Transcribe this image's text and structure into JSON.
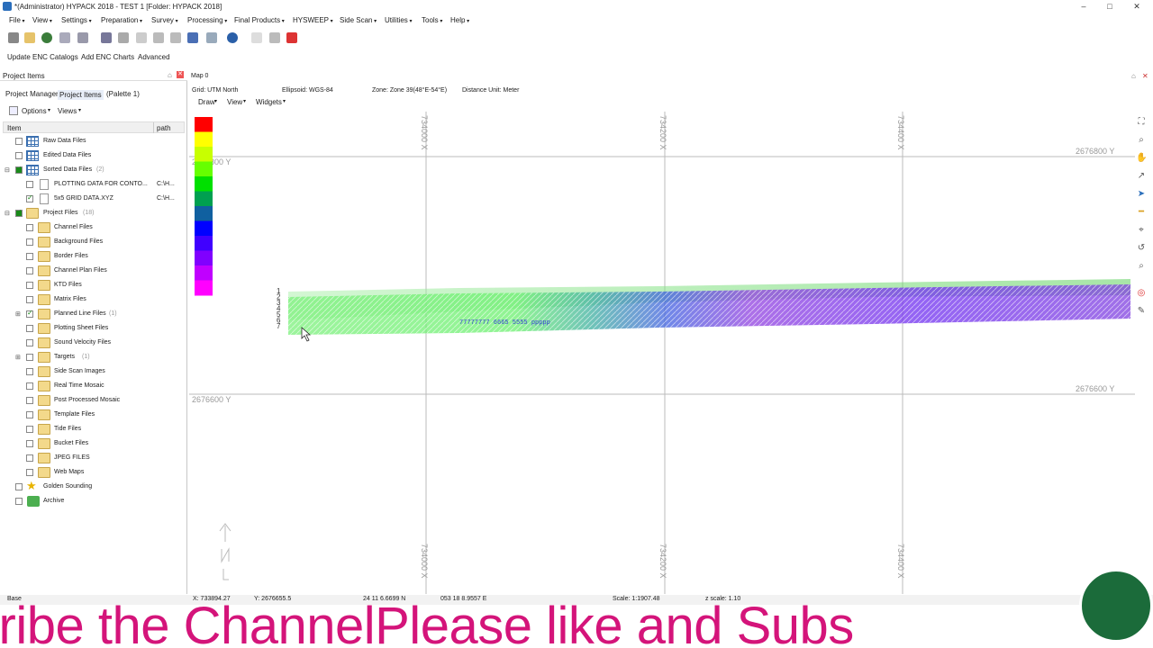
{
  "window": {
    "title": "*(Administrator) HYPACK 2018 - TEST 1  [Folder: HYPACK 2018]",
    "min": "–",
    "max": "□",
    "close": "✕"
  },
  "menu": [
    "File",
    "View",
    "Settings",
    "Preparation",
    "Survey",
    "Processing",
    "Final Products",
    "HYSWEEP",
    "Side Scan",
    "Utilities",
    "Tools",
    "Help"
  ],
  "subbar": {
    "update": "Update ENC Catalogs",
    "add": "Add ENC Charts",
    "advanced": "Advanced"
  },
  "left_panel": {
    "title": "Project Items",
    "tabs": [
      "Project Manager",
      "Project Items",
      "(Palette 1)"
    ],
    "options": "Options",
    "views": "Views",
    "col_item": "Item",
    "col_path": "path",
    "items": [
      {
        "label": "Raw Data Files",
        "count": ""
      },
      {
        "label": "Edited Data Files",
        "count": ""
      },
      {
        "label": "Sorted Data Files",
        "count": "(2)"
      },
      {
        "label": "PLOTTING DATA FOR CONTO...",
        "path": "C:\\H..."
      },
      {
        "label": "5x5 GRID DATA.XYZ",
        "path": "C:\\H..."
      },
      {
        "label": "Project Files",
        "count": "(18)"
      },
      {
        "label": "Channel Files"
      },
      {
        "label": "Background Files"
      },
      {
        "label": "Border Files"
      },
      {
        "label": "Channel Plan Files"
      },
      {
        "label": "KTD Files"
      },
      {
        "label": "Matrix Files"
      },
      {
        "label": "Planned Line Files",
        "count": "(1)"
      },
      {
        "label": "Plotting Sheet Files"
      },
      {
        "label": "Sound Velocity Files"
      },
      {
        "label": "Targets",
        "count": "(1)"
      },
      {
        "label": "Side Scan Images"
      },
      {
        "label": "Real Time Mosaic"
      },
      {
        "label": "Post Processed Mosaic"
      },
      {
        "label": "Template Files"
      },
      {
        "label": "Tide Files"
      },
      {
        "label": "Bucket Files"
      },
      {
        "label": "JPEG FILES"
      },
      {
        "label": "Web Maps"
      },
      {
        "label": "Golden Sounding"
      },
      {
        "label": "Archive"
      }
    ]
  },
  "map": {
    "title": "Map 0",
    "info": {
      "grid": "Grid: UTM North",
      "ellipsoid": "Ellipsoid: WGS-84",
      "zone": "Zone: Zone 39(48°E-54°E)",
      "unit": "Distance Unit: Meter"
    },
    "menus": [
      "Draw",
      "View",
      "Widgets"
    ],
    "x_labels": [
      "734000 X",
      "734200 X",
      "734400 X"
    ],
    "y_labels": [
      "2676800 Y",
      "2676600 Y"
    ],
    "color_scale": [
      "#ff0000",
      "#ffff00",
      "#c8ff00",
      "#66ff00",
      "#00e000",
      "#00a050",
      "#1060a0",
      "#0000ff",
      "#4000ff",
      "#8000ff",
      "#c000ff",
      "#ff00ff"
    ],
    "depth_digits": [
      "1",
      "2",
      "3",
      "4",
      "5",
      "6",
      "7"
    ],
    "sounding_sample": "77777777 6665 5555 ppppp"
  },
  "status": {
    "base": "Base",
    "x": "X: 733894.27",
    "y": "Y: 2676655.5",
    "lat": "24 11 6.6699 N",
    "lon": "053 18 8.9557 E",
    "scale": "Scale: 1:1907.48",
    "zscale": "z scale: 1.10"
  },
  "banner": {
    "text": "cribe the ChannelPlease like and Subs"
  }
}
